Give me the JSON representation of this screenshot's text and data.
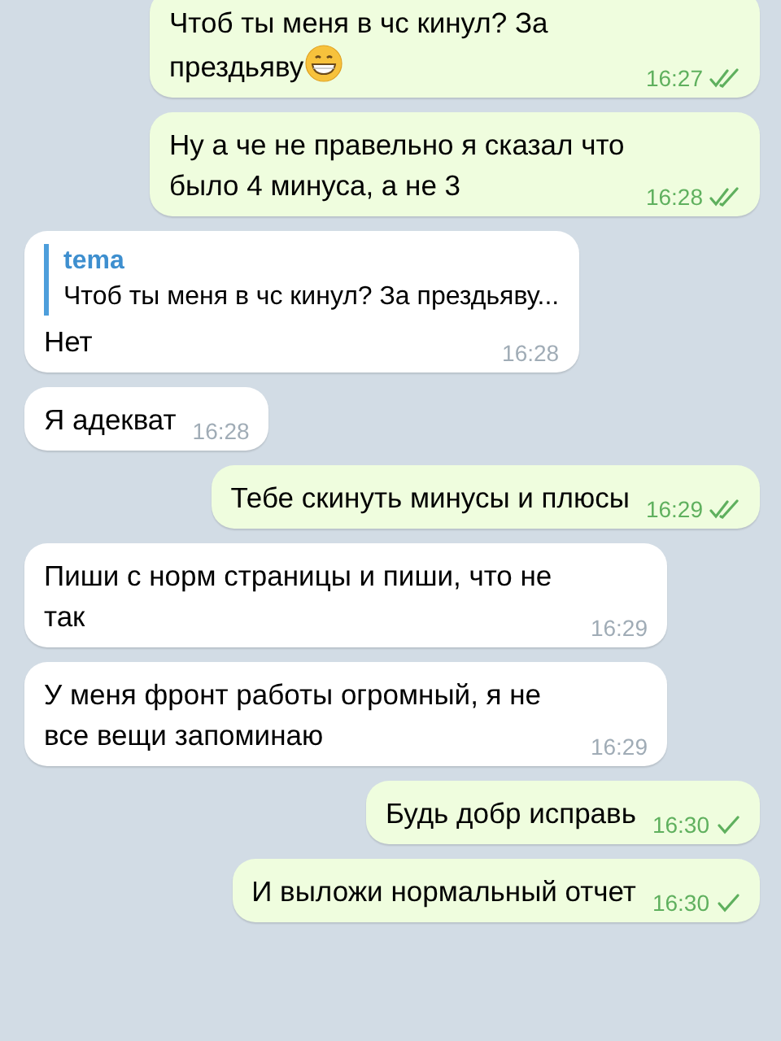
{
  "messages": [
    {
      "outgoing": true,
      "text": "Чтоб ты меня в чс кинул? За прездьяву",
      "emoji": true,
      "time": "16:27",
      "read": true
    },
    {
      "outgoing": true,
      "text": "Ну а че не правельно я сказал что было 4 минуса, а не 3",
      "time": "16:28",
      "read": true
    },
    {
      "outgoing": false,
      "reply": {
        "author": "tema",
        "text": "Чтоб ты меня в чс кинул? За прездьяву..."
      },
      "text": "Нет",
      "time": "16:28"
    },
    {
      "outgoing": false,
      "text": "Я адекват",
      "time": "16:28"
    },
    {
      "outgoing": true,
      "text": "Тебе скинуть минусы и плюсы",
      "time": "16:29",
      "read": true
    },
    {
      "outgoing": false,
      "text": "Пиши с норм страницы и пиши, что не так",
      "time": "16:29"
    },
    {
      "outgoing": false,
      "text": "У меня фронт работы огромный, я не все вещи запоминаю",
      "time": "16:29"
    },
    {
      "outgoing": true,
      "text": "Будь добр исправь",
      "time": "16:30",
      "read": false
    },
    {
      "outgoing": true,
      "text": "И выложи нормальный отчет",
      "time": "16:30",
      "read": false
    }
  ]
}
